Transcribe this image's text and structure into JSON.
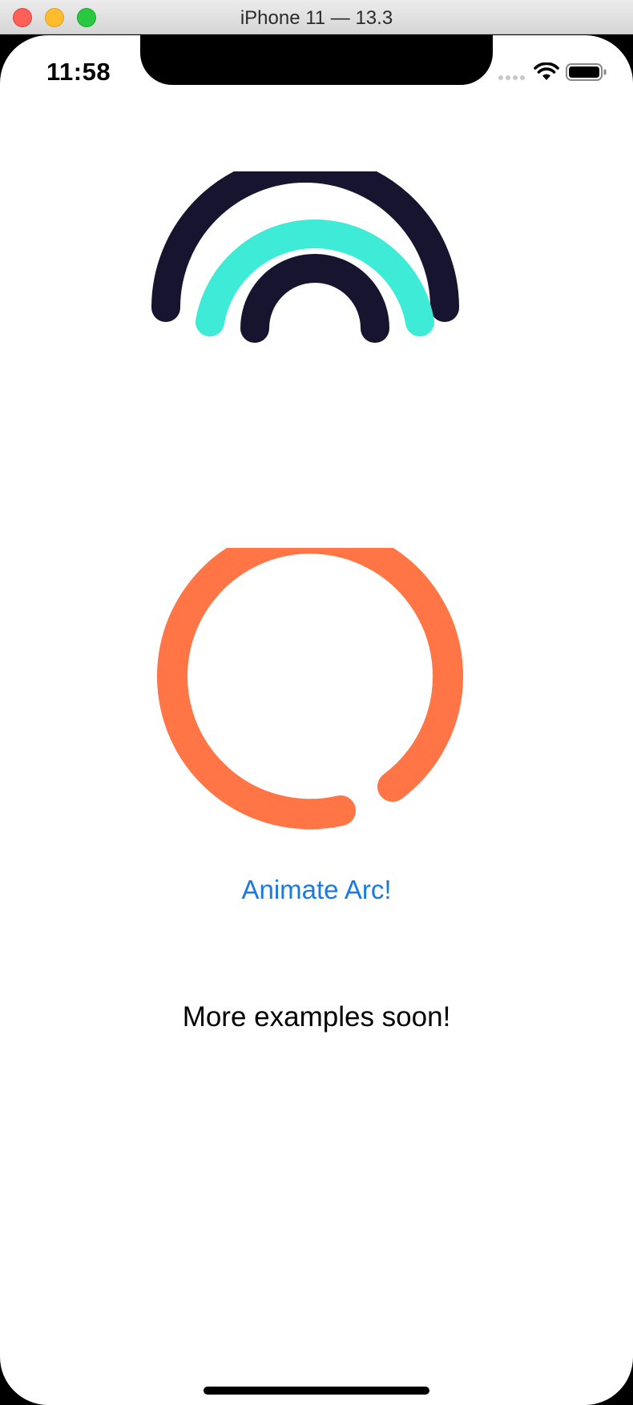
{
  "window": {
    "title": "iPhone 11 — 13.3"
  },
  "status_bar": {
    "time": "11:58",
    "icons": [
      "signal-icon",
      "wifi-icon",
      "battery-icon"
    ]
  },
  "colors": {
    "navy": "#16142e",
    "teal": "#3eebd6",
    "orange": "#ff7546",
    "link_blue": "#1a7ae3"
  },
  "main": {
    "animate_button_label": "Animate Arc!",
    "footer_text": "More examples soon!"
  }
}
